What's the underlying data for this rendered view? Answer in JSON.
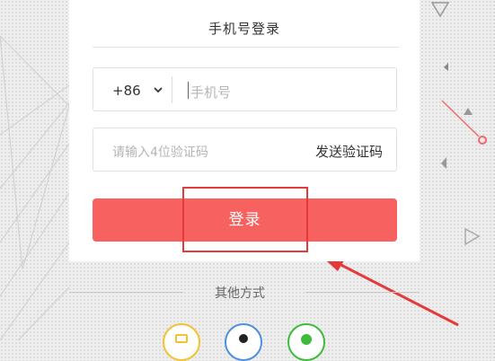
{
  "login": {
    "title": "手机号登录",
    "country_code": "+86",
    "phone_placeholder": "手机号",
    "code_placeholder": "请输入4位验证码",
    "send_code_label": "发送验证码",
    "login_label": "登录"
  },
  "other": {
    "label": "其他方式",
    "icons": [
      "login-option-yellow-icon",
      "login-option-blue-icon",
      "wechat-icon"
    ]
  },
  "colors": {
    "primary": "#f76261",
    "annotation": "#e43a3a"
  }
}
